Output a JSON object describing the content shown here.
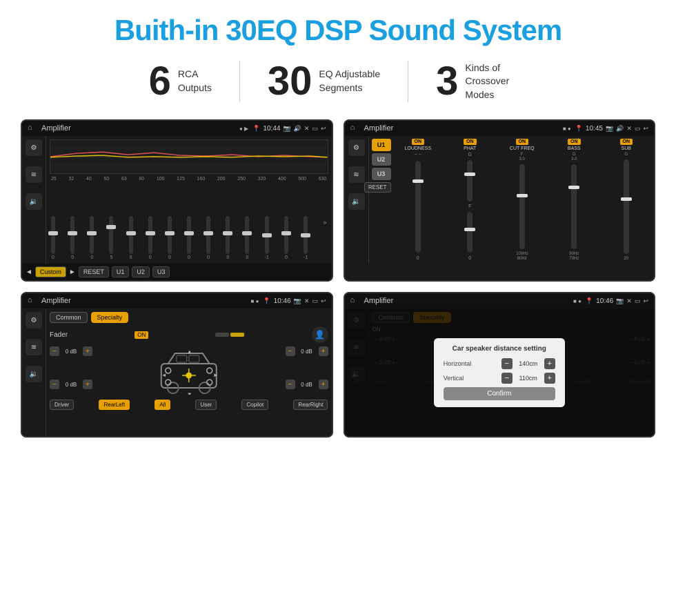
{
  "page": {
    "title": "Buith-in 30EQ DSP Sound System"
  },
  "stats": [
    {
      "number": "6",
      "label": "RCA\nOutputs"
    },
    {
      "number": "30",
      "label": "EQ Adjustable\nSegments"
    },
    {
      "number": "3",
      "label": "Kinds of\nCrossover Modes"
    }
  ],
  "screens": [
    {
      "id": "screen1",
      "status": {
        "title": "Amplifier",
        "time": "10:44"
      },
      "type": "eq",
      "freqs": [
        "25",
        "32",
        "40",
        "50",
        "63",
        "80",
        "100",
        "125",
        "160",
        "200",
        "250",
        "320",
        "400",
        "500",
        "630"
      ],
      "values": [
        "0",
        "0",
        "0",
        "5",
        "0",
        "0",
        "0",
        "0",
        "0",
        "0",
        "0",
        "-1",
        "0",
        "-1"
      ],
      "preset": "Custom",
      "buttons": [
        "RESET",
        "U1",
        "U2",
        "U3"
      ]
    },
    {
      "id": "screen2",
      "status": {
        "title": "Amplifier",
        "time": "10:45"
      },
      "type": "amplifier",
      "uButtons": [
        "U1",
        "U2",
        "U3"
      ],
      "channels": [
        "LOUDNESS",
        "PHAT",
        "CUT FREQ",
        "BASS",
        "SUB"
      ],
      "resetLabel": "RESET"
    },
    {
      "id": "screen3",
      "status": {
        "title": "Amplifier",
        "time": "10:46"
      },
      "type": "fader",
      "tabs": [
        "Common",
        "Specialty"
      ],
      "faderLabel": "Fader",
      "onBadge": "ON",
      "dbValues": [
        "0 dB",
        "0 dB",
        "0 dB",
        "0 dB"
      ],
      "bottomButtons": [
        "Driver",
        "RearLeft",
        "All",
        "User",
        "Copilot",
        "RearRight"
      ]
    },
    {
      "id": "screen4",
      "status": {
        "title": "Amplifier",
        "time": "10:46"
      },
      "type": "dialog",
      "tabs": [
        "Common",
        "Specialty"
      ],
      "dialog": {
        "title": "Car speaker distance setting",
        "fields": [
          {
            "label": "Horizontal",
            "value": "140cm"
          },
          {
            "label": "Vertical",
            "value": "110cm"
          }
        ],
        "confirmLabel": "Confirm"
      },
      "bottomButtons": [
        "Driver",
        "RearLeft",
        "All",
        "User",
        "Copilot",
        "RearRight"
      ]
    }
  ]
}
